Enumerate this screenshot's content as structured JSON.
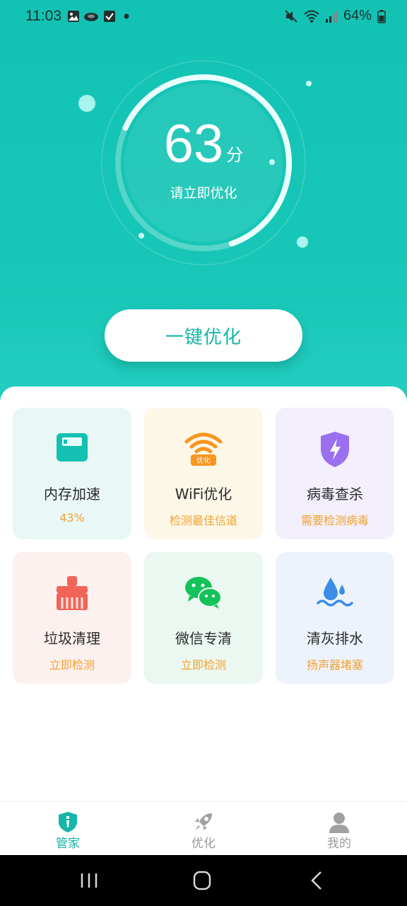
{
  "status_bar": {
    "time": "11:03",
    "battery": "64%",
    "icons": [
      "image-icon",
      "cloud-icon",
      "check-icon",
      "dot-icon",
      "mute-icon",
      "wifi-icon",
      "signal-icon",
      "battery-icon"
    ]
  },
  "score": {
    "value": "63",
    "unit": "分",
    "hint": "请立即优化",
    "progress": 0.63
  },
  "optimize_button": {
    "label": "一键优化"
  },
  "features": [
    {
      "icon": "memory-icon",
      "title": "内存加速",
      "subtitle": "43%",
      "bg": "#e9f8f7"
    },
    {
      "icon": "wifi-optimize-icon",
      "title": "WiFi优化",
      "subtitle": "检测最佳信道",
      "bg": "#fdf7e8"
    },
    {
      "icon": "shield-icon",
      "title": "病毒查杀",
      "subtitle": "需要检测病毒",
      "bg": "#f3effc"
    },
    {
      "icon": "broom-icon",
      "title": "垃圾清理",
      "subtitle": "立即检测",
      "bg": "#fdf1ef"
    },
    {
      "icon": "wechat-icon",
      "title": "微信专清",
      "subtitle": "立即检测",
      "bg": "#ebf8f1"
    },
    {
      "icon": "water-drop-icon",
      "title": "清灰排水",
      "subtitle": "扬声器堵塞",
      "bg": "#edf3fd"
    }
  ],
  "bottom_nav": [
    {
      "icon": "housekeeper-icon",
      "label": "管家",
      "active": true
    },
    {
      "icon": "rocket-icon",
      "label": "优化",
      "active": false
    },
    {
      "icon": "user-icon",
      "label": "我的",
      "active": false
    }
  ],
  "colors": {
    "accent": "#13b6a7",
    "hero_top": "#12c3b4",
    "subtitle_orange": "#f2a12e"
  }
}
